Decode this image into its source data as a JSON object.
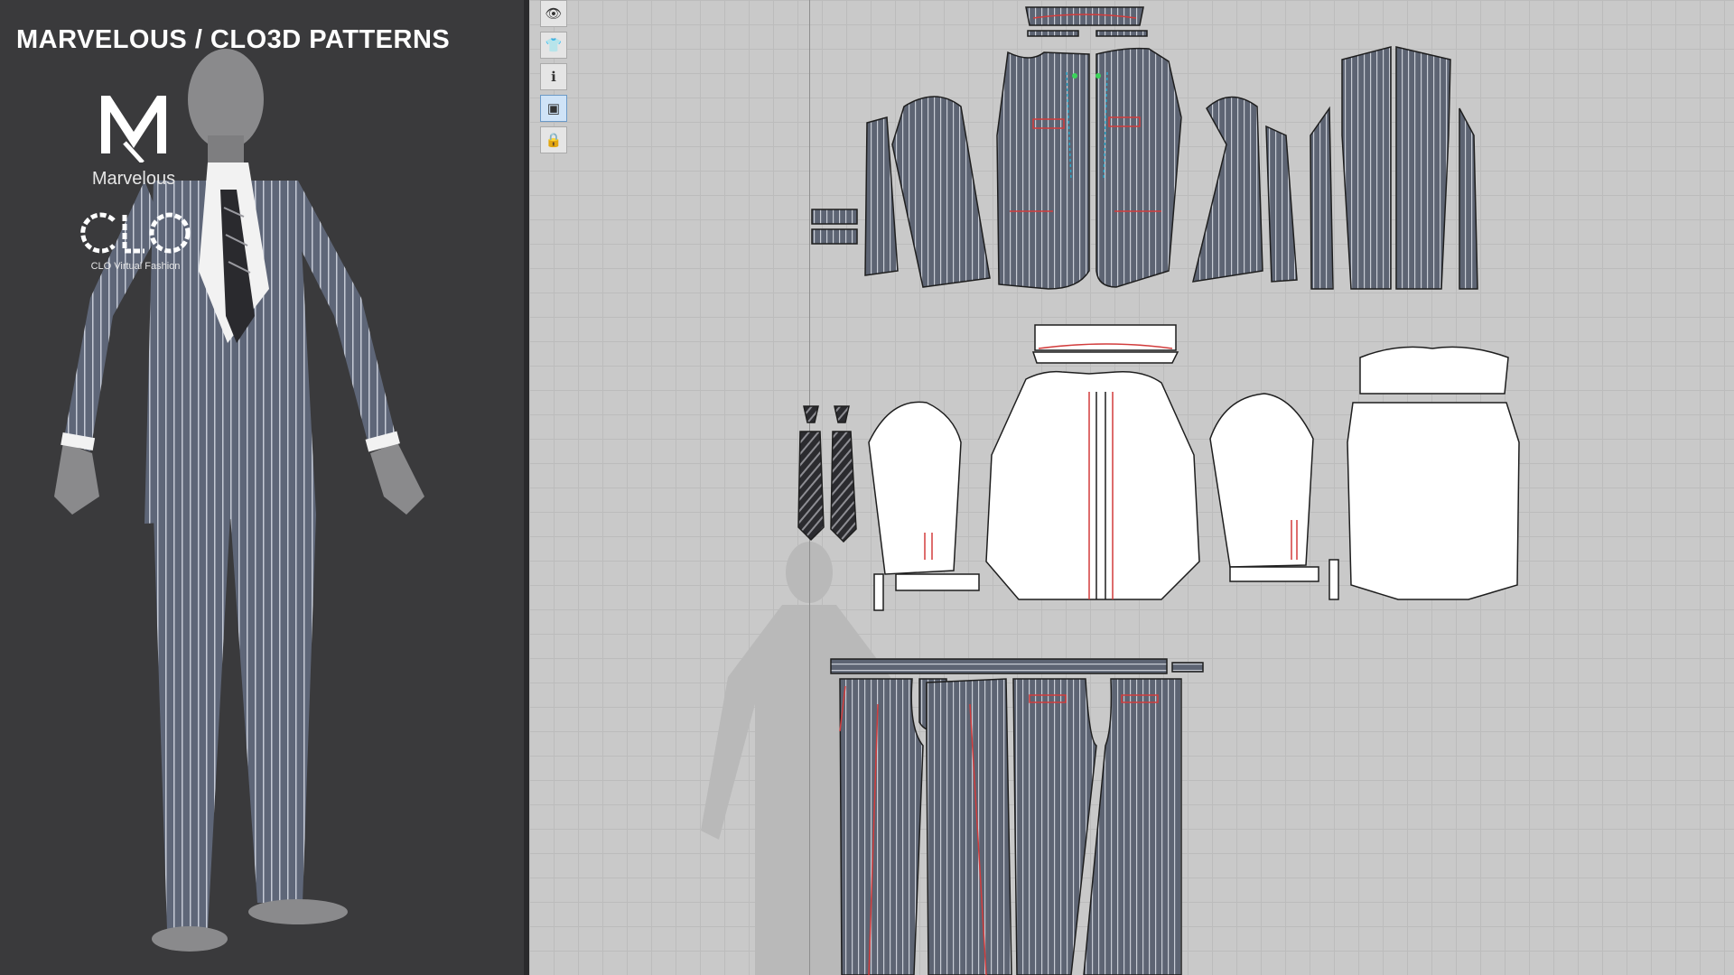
{
  "header": {
    "title": "MARVELOUS / CLO3D PATTERNS"
  },
  "logos": {
    "marvelous_label": "Marvelous",
    "clo_label": "CLO Virtual Fashion"
  },
  "toolbar": {
    "tools": [
      {
        "icon": "eye-icon",
        "glyph": "👁"
      },
      {
        "icon": "shirt-show-icon",
        "glyph": "👕"
      },
      {
        "icon": "info-icon",
        "glyph": "ℹ"
      },
      {
        "icon": "texture-icon",
        "glyph": "▣"
      },
      {
        "icon": "lock-shirt-icon",
        "glyph": "🔒"
      }
    ]
  },
  "colors": {
    "background_panel": "#3a3a3c",
    "grid_background": "#c9c9c9",
    "fabric_navy": "#5d6473",
    "pinstripe": "#c9cdd6",
    "shirt_white": "#ffffff",
    "seam_red": "#d23c3c"
  }
}
